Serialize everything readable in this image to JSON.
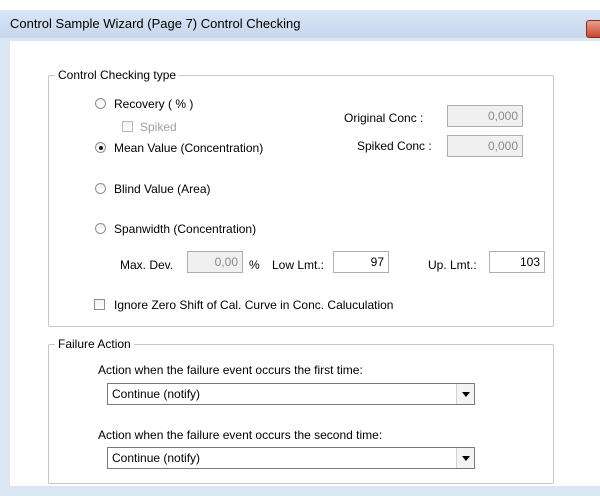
{
  "window": {
    "title": "Control Sample Wizard (Page 7) Control Checking"
  },
  "control_checking": {
    "group_title": "Control Checking type",
    "options": [
      {
        "label": "Recovery ( % )",
        "selected": false
      },
      {
        "label": "Mean Value (Concentration)",
        "selected": true
      },
      {
        "label": "Blind Value (Area)",
        "selected": false
      },
      {
        "label": "Spanwidth (Concentration)",
        "selected": false
      }
    ],
    "spiked": {
      "label": "Spiked",
      "checked": false,
      "enabled": false
    },
    "original_conc": {
      "label": "Original Conc :",
      "value": "0,000",
      "enabled": false
    },
    "spiked_conc": {
      "label": "Spiked Conc :",
      "value": "0,000",
      "enabled": false
    },
    "max_dev": {
      "label": "Max. Dev.",
      "value": "0,00",
      "unit": "%",
      "enabled": false
    },
    "low_lmt": {
      "label": "Low Lmt.:",
      "value": "97"
    },
    "up_lmt": {
      "label": "Up. Lmt.:",
      "value": "103"
    },
    "ignore_zero_shift": {
      "label": "Ignore Zero Shift of Cal. Curve in Conc. Caluculation",
      "checked": false
    }
  },
  "failure_action": {
    "group_title": "Failure Action",
    "first_label": "Action when the failure event occurs the first time:",
    "first_value": "Continue (notify)",
    "second_label": "Action when the failure event occurs the second time:",
    "second_value": "Continue (notify)"
  },
  "colors": {
    "title_bar": "#c6d6ec",
    "close_button": "#c9482f",
    "group_border": "#c7c7c7"
  }
}
